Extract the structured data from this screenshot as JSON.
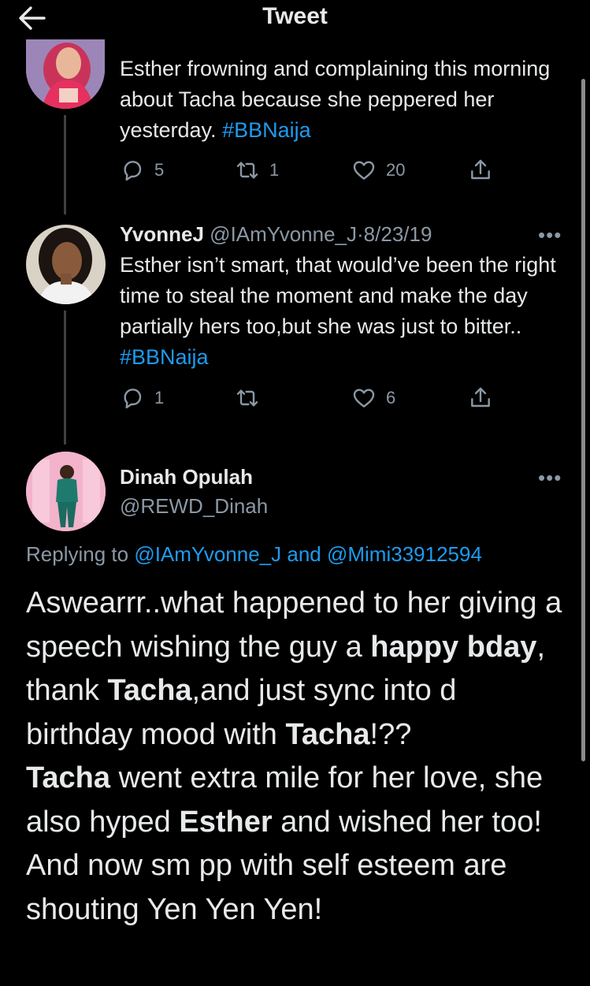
{
  "header": {
    "title": "Tweet"
  },
  "tweets": [
    {
      "text_parts": [
        "Esther frowning and complaining this morning about Tacha because she peppered her yesterday. ",
        "#BBNaija"
      ],
      "replies": "5",
      "retweets": "1",
      "likes": "20"
    },
    {
      "name": "YvonneJ",
      "handle": "@IAmYvonne_J",
      "separator": "·",
      "date": "8/23/19",
      "text_parts": [
        "Esther isn’t smart, that would’ve been the right time to steal the moment and make the day partially hers too,but she was just to bitter.. ",
        "#BBNaija"
      ],
      "replies": "1",
      "retweets": "",
      "likes": "6"
    }
  ],
  "main_tweet": {
    "name": "Dinah Opulah",
    "handle": "@REWD_Dinah",
    "replying_prefix": "Replying to ",
    "replying_to_1": "@IAmYvonne_J",
    "replying_and": " and ",
    "replying_to_2": "@Mimi33912594",
    "body": [
      "Aswearrr..what happened to her giving a speech wishing the guy a ",
      "happy bday",
      ", thank ",
      "Tacha",
      ",and just sync into d birthday mood with ",
      "Tacha",
      "!??",
      " ",
      "Tacha",
      " went extra mile for her love, she also hyped ",
      "Esther",
      " and wished her too! And now sm pp with self esteem are shouting Yen Yen Yen!"
    ]
  },
  "more_label": "•••",
  "colors": {
    "background": "#000000",
    "text": "#e7e9ea",
    "muted": "#8b98a5",
    "link": "#1d9bf0"
  }
}
